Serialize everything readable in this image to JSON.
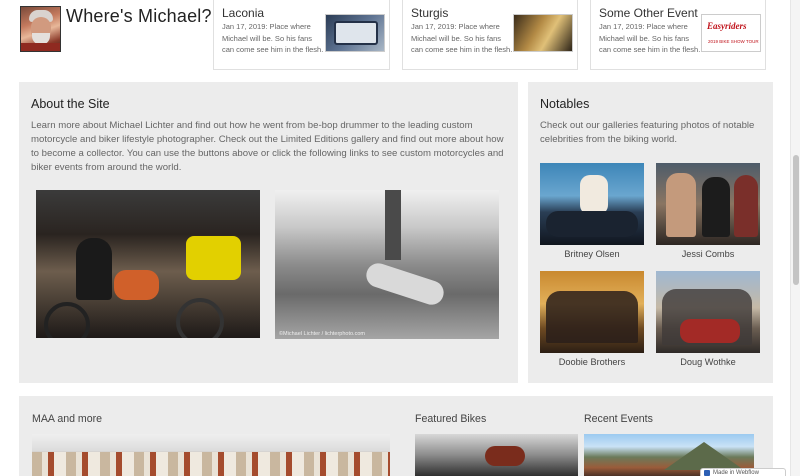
{
  "site": {
    "title": "Where's Michael?"
  },
  "events": [
    {
      "title": "Laconia",
      "text": "Jan 17, 2019: Place where Michael will be. So his fans can come see him in the flesh.",
      "thumb_alt": "laconia-poster-thumb"
    },
    {
      "title": "Sturgis",
      "text": "Jan 17, 2019: Place where Michael will be. So his fans can come see him in the flesh.",
      "thumb_alt": "sturgis-bike-thumb"
    },
    {
      "title": "Some Other Event",
      "text": "Jan 17, 2019: Place where Michael will be. So his fans can come see him in the flesh.",
      "logo_main": "Easyriders",
      "logo_sub": "2019 BIKE SHOW TOUR"
    }
  ],
  "about": {
    "title": "About the Site",
    "text": "Learn more about Michael Lichter and find out how he went from be-bop drummer to the leading custom motorcycle and biker lifestyle photographer. Check out the Limited Editions gallery and find out more about how to become a collector. You can use the buttons above or click the following links to see custom motorcycles and biker events from around the world.",
    "photo2_caption": "©Michael Lichter / lichterphoto.com"
  },
  "notables": {
    "title": "Notables",
    "text": "Check out our galleries featuring photos of notable celebrities from the biking world.",
    "items": [
      {
        "name": "Britney Olsen"
      },
      {
        "name": "Jessi Combs"
      },
      {
        "name": "Doobie Brothers"
      },
      {
        "name": "Doug Wothke"
      }
    ]
  },
  "bottom": {
    "col1_title": "MAA and more",
    "col2_title": "Featured Bikes",
    "col3_title": "Recent Events"
  },
  "toast": {
    "text": "Made in Webflow"
  },
  "colors": {
    "panel": "#ececec",
    "card_border": "#e0e0e0",
    "easyriders_red": "#c0121a"
  }
}
